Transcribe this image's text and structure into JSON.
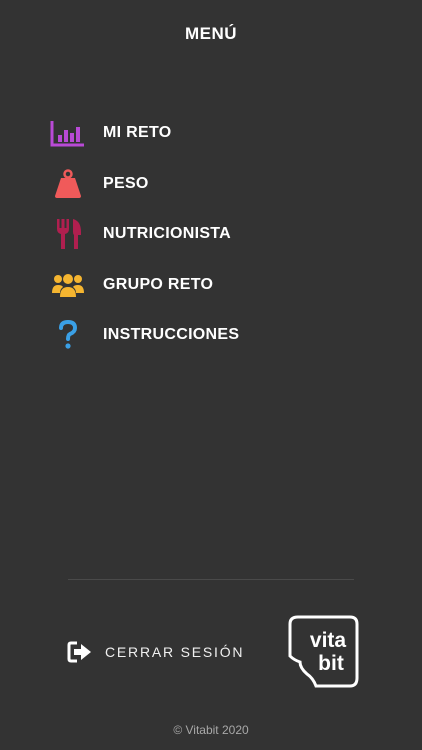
{
  "header": {
    "title": "MENÚ"
  },
  "menu": {
    "items": [
      {
        "label": "MI RETO",
        "icon": "bar-chart-icon",
        "color": "#b94ad6"
      },
      {
        "label": "PESO",
        "icon": "weight-icon",
        "color": "#f05a5a"
      },
      {
        "label": "NUTRICIONISTA",
        "icon": "fork-knife-icon",
        "color": "#b01f4f"
      },
      {
        "label": "GRUPO RETO",
        "icon": "group-icon",
        "color": "#f5b530"
      },
      {
        "label": "INSTRUCCIONES",
        "icon": "question-icon",
        "color": "#3aa0e6"
      }
    ]
  },
  "logout": {
    "label": "CERRAR SESIÓN",
    "icon": "sign-out-icon"
  },
  "logo": {
    "line1": "vita",
    "line2": "bit"
  },
  "footer": {
    "copyright": "© Vitabit 2020"
  }
}
